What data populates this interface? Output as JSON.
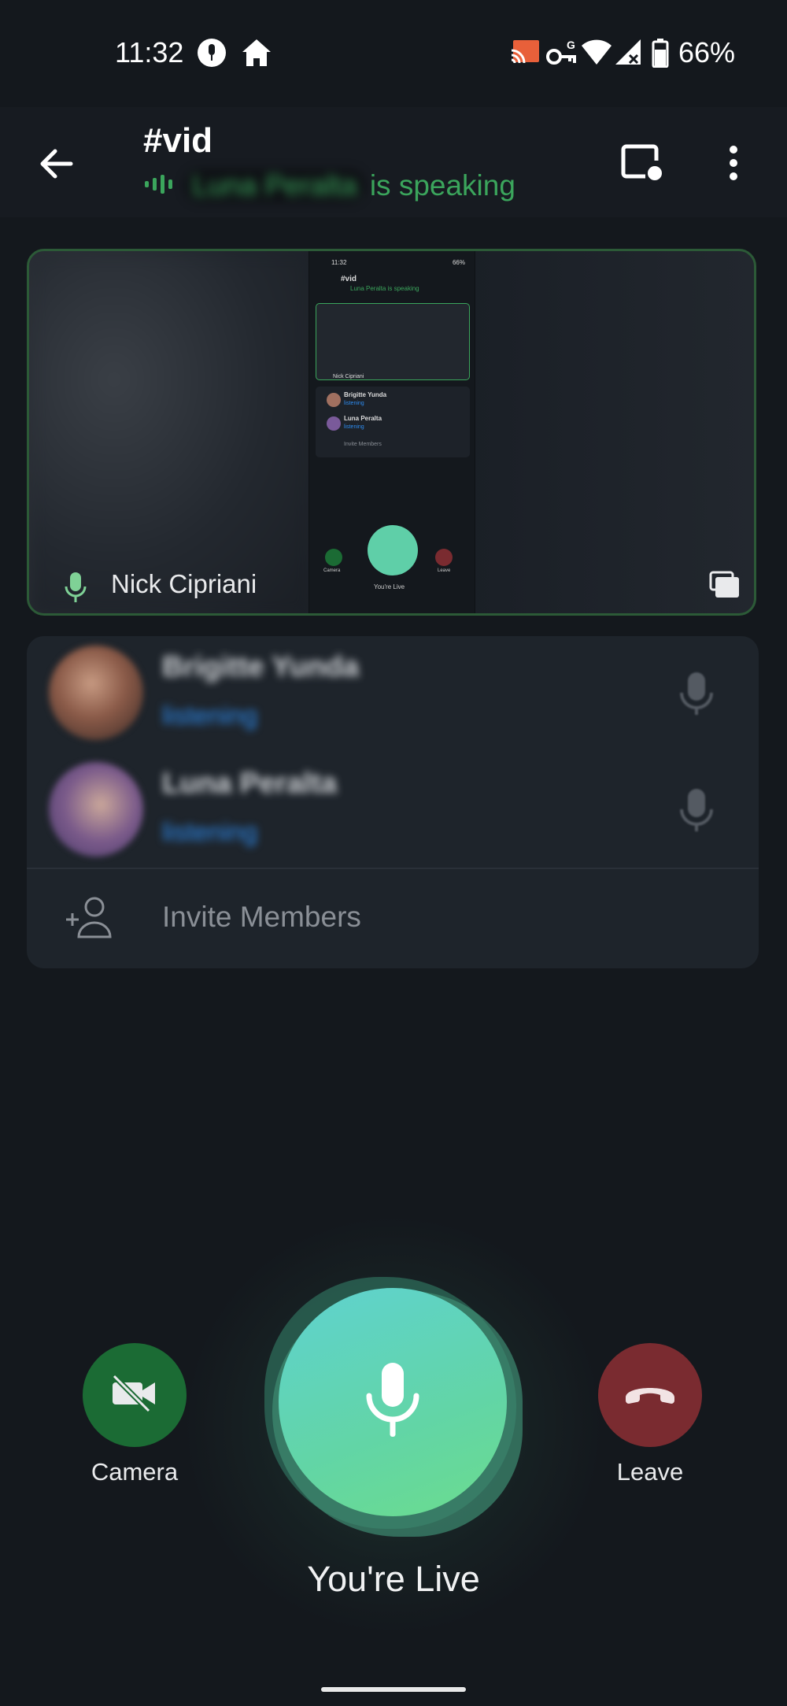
{
  "status_bar": {
    "time": "11:32",
    "battery": "66%",
    "icons": [
      "podcast-mic-icon",
      "home-icon",
      "cast-icon",
      "key-icon",
      "wifi-icon",
      "signal-icon",
      "battery-icon"
    ]
  },
  "header": {
    "channel": "#vid",
    "speaker_name": "Luna Peralta",
    "speaking_suffix": "is speaking"
  },
  "video": {
    "participant": "Nick Cipriani",
    "mini_preview": {
      "time": "11:32",
      "battery": "66%",
      "title": "#vid",
      "speaking": "Luna Peralta is speaking",
      "nick": "Nick Cipriani",
      "p1": "Brigitte Yunda",
      "p2": "Luna Peralta",
      "status": "listening",
      "invite": "Invite Members",
      "camera": "Camera",
      "leave": "Leave",
      "live": "You're Live"
    }
  },
  "participants": [
    {
      "name": "Brigitte Yunda",
      "status": "listening"
    },
    {
      "name": "Luna Peralta",
      "status": "listening"
    }
  ],
  "invite_label": "Invite Members",
  "controls": {
    "camera_label": "Camera",
    "leave_label": "Leave",
    "live_label": "You're Live"
  },
  "colors": {
    "background": "#14181d",
    "speaking_green": "#3ba55c",
    "listening_blue": "#2d8cf0",
    "camera_green": "#1b6b34",
    "leave_red": "#7a2b30",
    "live_teal": "#62d5a6"
  }
}
